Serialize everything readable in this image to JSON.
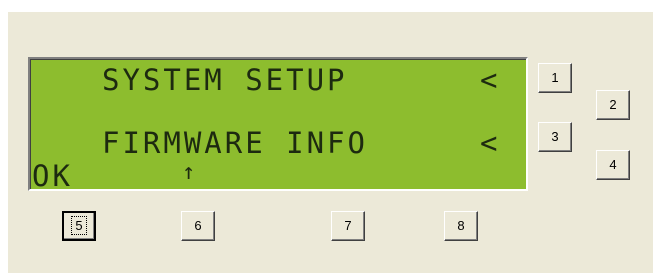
{
  "lcd": {
    "line1": "SYSTEM SETUP",
    "line2": "FIRMWARE INFO",
    "caret1": "<",
    "caret2": "<",
    "ok": "OK",
    "arrow": "↑"
  },
  "buttons": {
    "b1": "1",
    "b2": "2",
    "b3": "3",
    "b4": "4",
    "b5": "5",
    "b6": "6",
    "b7": "7",
    "b8": "8"
  },
  "colors": {
    "lcd_background": "#8dbd2e",
    "lcd_text": "#1d2a10",
    "panel_background": "#ece9d8"
  }
}
